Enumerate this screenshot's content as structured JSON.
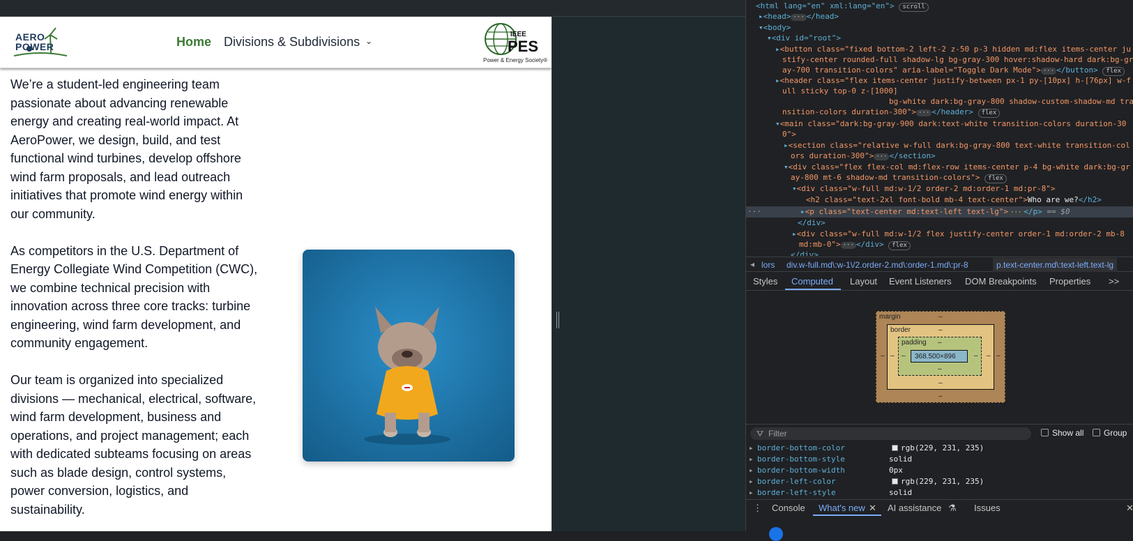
{
  "site": {
    "logo_line1": "AERO",
    "logo_line2": "POWER",
    "nav_home": "Home",
    "nav_divisions": "Divisions & Subdivisions",
    "ieee_logo": "IEEE",
    "pes_logo": "PES",
    "pes_sub": "Power & Energy Society®",
    "paragraphs": [
      "We’re a student-led engineering team passionate about advancing renewable energy and creating real-world impact. At AeroPower, we design, build, and test functional wind turbines, develop offshore wind farm proposals, and lead outreach initiatives that promote wind energy within our community.",
      "As competitors in the U.S. Department of Energy Collegiate Wind Competition (CWC), we combine technical precision with innovation across three core tracks: turbine engineering, wind farm development, and community engagement.",
      "Our team is organized into specialized divisions — mechanical, electrical, software, wind farm development, business and operations, and project management; each with dedicated subteams focusing on areas such as blade design, control systems, power conversion, logistics, and sustainability."
    ]
  },
  "devtools": {
    "dom": {
      "html_open": "<html lang=\"en\" xml:lang=\"en\">",
      "scroll_badge": "scroll",
      "head": "<head>",
      "head_close": "</head>",
      "body": "<body>",
      "root": "<div id=\"root\">",
      "button_1": "<button class=\"fixed bottom-2 left-2 z-50 p-3 hidden md:flex items-center ju",
      "button_2": "stify-center rounded-full shadow-lg bg-gray-300 hover:shadow-hard dark:bg-gr",
      "button_3": "ay-700 transition-colors\" aria-label=\"Toggle Dark Mode\">",
      "button_close": "</button>",
      "flex_badge": "flex",
      "header_1": "<header class=\"flex items-center justify-between px-1 py-[10px] h-[76px] w-f",
      "header_2": "ull sticky top-0 z-[1000]",
      "header_3": "bg-white dark:bg-gray-800 shadow-custom-shadow-md tra",
      "header_4": "nsition-colors duration-300\">",
      "header_close": "</header>",
      "main_1": "<main class=\"dark:bg-gray-900 dark:text-white transition-colors duration-30",
      "main_2": "0\">",
      "section_1": "<section class=\"relative w-full dark:bg-gray-800 text-white transition-col",
      "section_2": "ors duration-300\">",
      "section_close": "</section>",
      "div1_1": "<div class=\"flex flex-col md:flex-row items-center p-4 bg-white dark:bg-gr",
      "div1_2": "ay-800 mt-6 shadow-md transition-colors\">",
      "div2": "<div class=\"w-full md:w-1/2 order-2 md:order-1 md:pr-8\">",
      "h2": "<h2 class=\"text-2xl font-bold mb-4 text-center\">",
      "h2_text": "Who are we?",
      "h2_close": "</h2>",
      "p_open": "<p class=\"text-center md:text-left text-lg\">",
      "p_close": "</p>",
      "dollar0": "== $0",
      "div_close": "</div>",
      "div3_1": "<div class=\"w-full md:w-1/2 flex justify-center order-1 md:order-2 mb-8",
      "div3_2": "md:mb-0\">",
      "div3_close": "</div>",
      "trunc": "</div>",
      "dots": "···"
    },
    "breadcrumbs": [
      "lors",
      "div.w-full.md\\:w-1\\/2.order-2.md\\:order-1.md\\:pr-8",
      "p.text-center.md\\:text-left.text-lg"
    ],
    "tabs": [
      "Styles",
      "Computed",
      "Layout",
      "Event Listeners",
      "DOM Breakpoints",
      "Properties"
    ],
    "more_tabs": ">>",
    "box_model": {
      "margin": "margin",
      "border": "border",
      "padding": "padding",
      "content": "368.500×896",
      "dash": "–"
    },
    "filter_placeholder": "Filter",
    "show_all": "Show all",
    "group": "Group",
    "properties": [
      {
        "name": "border-bottom-color",
        "value": "rgb(229, 231, 235)",
        "swatch": "#e5e7eb"
      },
      {
        "name": "border-bottom-style",
        "value": "solid"
      },
      {
        "name": "border-bottom-width",
        "value": "0px"
      },
      {
        "name": "border-left-color",
        "value": "rgb(229, 231, 235)",
        "swatch": "#e5e7eb"
      },
      {
        "name": "border-left-style",
        "value": "solid"
      }
    ],
    "drawer_tabs": [
      "Console",
      "What's new",
      "AI assistance",
      "Issues"
    ]
  },
  "colors": {
    "accent": "#7cacf8",
    "nav_home": "#3d7a35",
    "margin_box": "#ad8556",
    "border_box": "#e3c381",
    "padding_box": "#b6c37d",
    "content_box": "#8bb6c9"
  }
}
